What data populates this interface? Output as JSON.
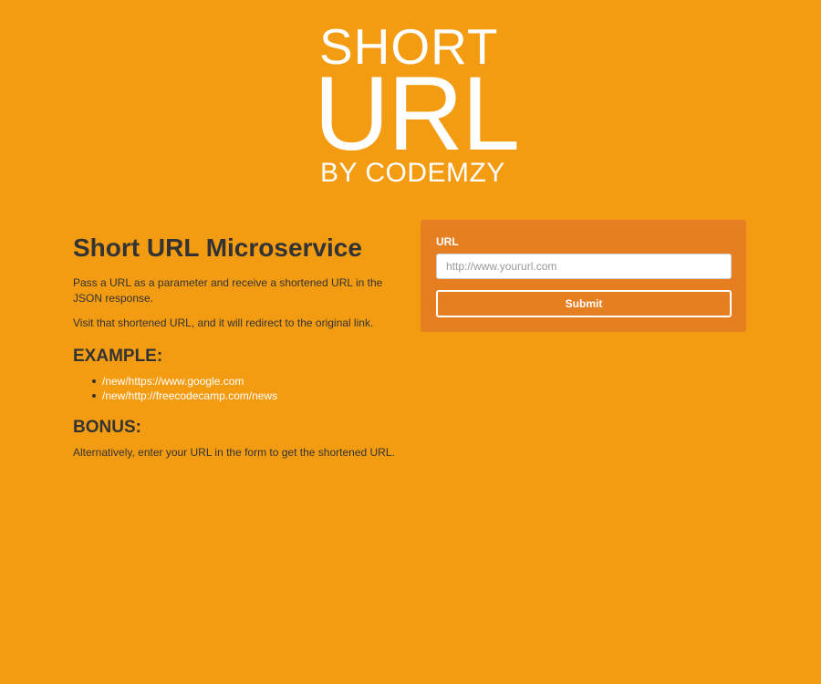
{
  "logo": {
    "line1": "SHORT",
    "line2": "URL",
    "line3": "BY CODEMZY"
  },
  "intro": {
    "title": "Short URL Microservice",
    "paragraph1": "Pass a URL as a parameter and receive a shortened URL in the JSON response.",
    "paragraph2": "Visit that shortened URL, and it will redirect to the original link.",
    "example_heading": "EXAMPLE:",
    "examples": [
      {
        "label": "/new/https://www.google.com"
      },
      {
        "label": "/new/http://freecodecamp.com/news"
      }
    ],
    "bonus_heading": "BONUS:",
    "bonus_text": "Alternatively, enter your URL in the form to get the shortened URL."
  },
  "form": {
    "label": "URL",
    "placeholder": "http://www.yoururl.com",
    "value": "",
    "submit_label": "Submit"
  },
  "colors": {
    "background": "#f39c12",
    "panel": "#e67e22",
    "text": "#333333",
    "link": "#ffffff"
  }
}
